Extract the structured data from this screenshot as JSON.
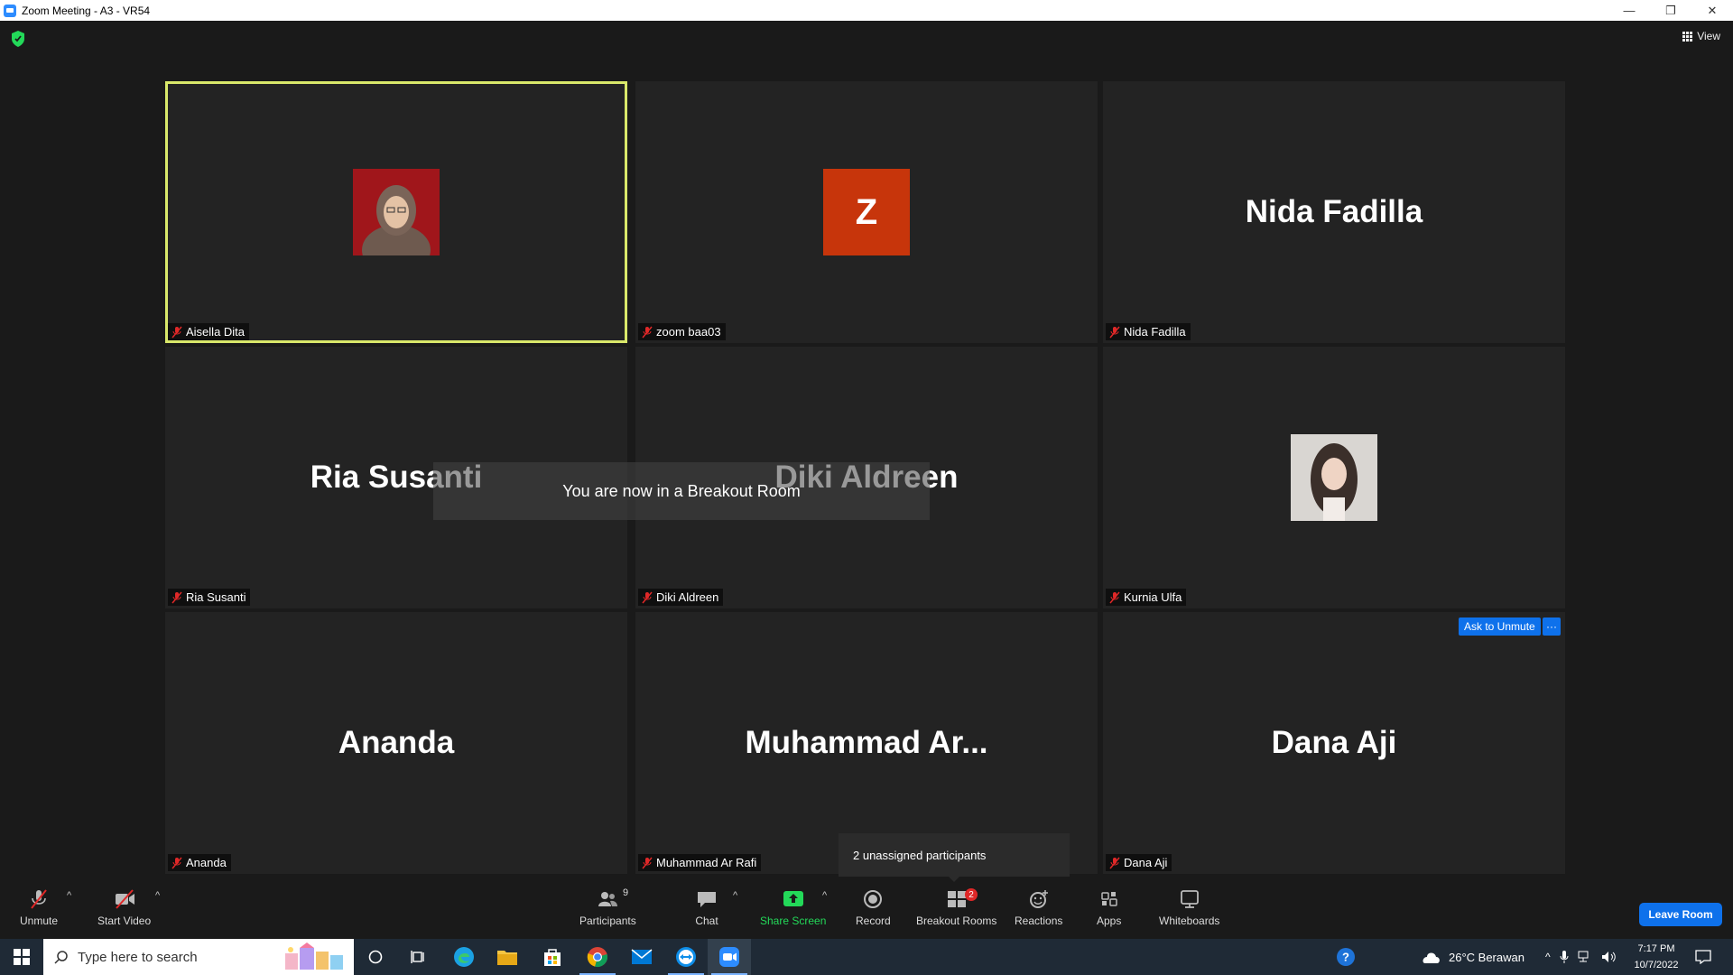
{
  "window": {
    "title": "Zoom Meeting - A3 - VR54",
    "minimize": "—",
    "restore": "❐",
    "close": "✕"
  },
  "header": {
    "view_label": "View"
  },
  "tiles": [
    {
      "name": "Aisella Dita",
      "display": "",
      "type": "photo-red"
    },
    {
      "name": "zoom baa03",
      "display": "Z",
      "type": "letter"
    },
    {
      "name": "Nida Fadilla",
      "display": "Nida Fadilla",
      "type": "text"
    },
    {
      "name": "Ria Susanti",
      "display": "Ria Susanti",
      "type": "text"
    },
    {
      "name": "Diki Aldreen",
      "display": "Diki Aldreen",
      "type": "text"
    },
    {
      "name": "Kurnia Ulfa",
      "display": "",
      "type": "photo-gray"
    },
    {
      "name": "Ananda",
      "display": "Ananda",
      "type": "text"
    },
    {
      "name": "Muhammad Ar Rafi",
      "display": "Muhammad  Ar...",
      "type": "text"
    },
    {
      "name": "Dana Aji",
      "display": "Dana Aji",
      "type": "text"
    }
  ],
  "ask_unmute": "Ask to Unmute",
  "more": "···",
  "breakout_toast": "You are now in a Breakout Room",
  "unassigned_popup": "2 unassigned participants",
  "toolbar": {
    "unmute": "Unmute",
    "start_video": "Start Video",
    "participants": "Participants",
    "participants_count": "9",
    "chat": "Chat",
    "share_screen": "Share Screen",
    "record": "Record",
    "breakout_rooms": "Breakout Rooms",
    "breakout_count": "2",
    "reactions": "Reactions",
    "apps": "Apps",
    "whiteboards": "Whiteboards",
    "leave": "Leave Room",
    "caret": "^"
  },
  "taskbar": {
    "search_placeholder": "Type here to search",
    "weather": "26°C  Berawan",
    "time": "7:17 PM",
    "date": "10/7/2022"
  },
  "colors": {
    "accent": "#0e71eb",
    "share_green": "#23d959",
    "active_speaker": "#d9e86a",
    "letter_avatar": "#c7350b"
  }
}
